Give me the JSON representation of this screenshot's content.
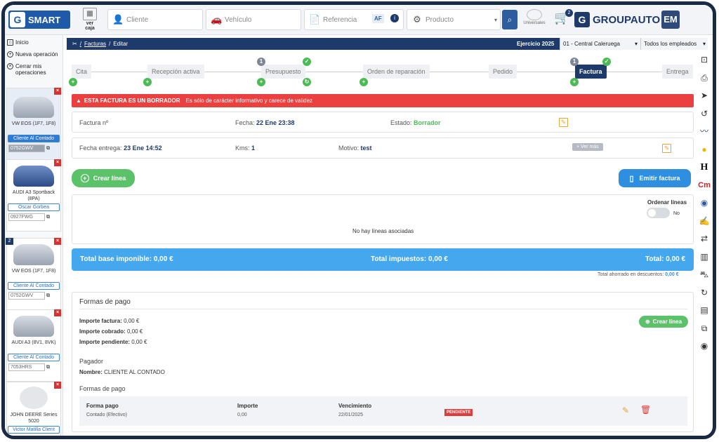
{
  "app": {
    "logo_text": "SMART",
    "caja_label": "ver caja",
    "brand": "GROUPAUTO",
    "avatar": "EM",
    "cart_count": "2",
    "universales": "Universales"
  },
  "search": {
    "cliente": "Cliente",
    "vehiculo": "Vehículo",
    "referencia": "Referencia",
    "af": "AF",
    "producto": "Producto"
  },
  "leftnav": {
    "inicio": "Inicio",
    "nueva": "Nueva operación",
    "cerrar": "Cerrar mis operaciones"
  },
  "cards": [
    {
      "name": "VW EOS (1F7, 1F8)",
      "client": "Cliente Al Contado",
      "plate": "0752GWV"
    },
    {
      "name": "AUDI A3 Sportback (8PA)",
      "client": "Oscar Gorbea",
      "plate": "0927FWG"
    },
    {
      "name": "VW EOS (1F7, 1F8)",
      "client": "Cliente Al Contado",
      "plate": "0752GWV",
      "num": "2"
    },
    {
      "name": "AUDI A3 (8V1, 8VK)",
      "client": "Cliente Al Contado",
      "plate": "7053HRS"
    },
    {
      "name": "JOHN DEERE Series 5020",
      "client": "Victor Matilla Client"
    }
  ],
  "breadcrumb": {
    "facturas": "Facturas",
    "editar": "Editar",
    "ejercicio": "Ejercicio 2025",
    "centro": "01 - Central Caleruega",
    "empleados": "Todos los empleados"
  },
  "steps": [
    "Cita",
    "Recepción activa",
    "Presupuesto",
    "Orden de reparación",
    "Pedido",
    "Factura",
    "Entrega"
  ],
  "step_badges": {
    "presupuesto": "1",
    "factura": "1"
  },
  "alert": {
    "title": "ESTA FACTURA ES UN BORRADOR",
    "text": "Es sólo de carácter informativo y carece de validez"
  },
  "factura": {
    "num_label": "Factura nº",
    "fecha_label": "Fecha:",
    "fecha": "22 Ene 23:38",
    "estado_label": "Estado:",
    "estado": "Borrador",
    "entrega_label": "Fecha entrega:",
    "entrega": "23 Ene 14:52",
    "kms_label": "Kms:",
    "kms": "1",
    "motivo_label": "Motivo:",
    "motivo": "test",
    "ver_mas": "Ver más"
  },
  "actions": {
    "crear_linea": "Crear línea",
    "emitir": "Emitir factura"
  },
  "lines": {
    "ordenar": "Ordenar líneas",
    "no": "No",
    "empty": "No hay líneas asociadas"
  },
  "totals": {
    "base": "Total base imponible: 0,00 €",
    "impuestos": "Total impuestos: 0,00 €",
    "total": "Total: 0,00 €",
    "ahorrado_label": "Total ahorrado en descuentos:",
    "ahorrado": "0,00 €"
  },
  "pago": {
    "title": "Formas de pago",
    "crear": "Crear línea",
    "imp_fact": "Importe factura:",
    "imp_fact_v": "0,00 €",
    "imp_cobr": "Importe cobrado:",
    "imp_cobr_v": "0,00 €",
    "imp_pend": "Importe pendiente:",
    "imp_pend_v": "0,00 €",
    "pagador": "Pagador",
    "nombre_label": "Nombre:",
    "nombre": "CLIENTE AL CONTADO",
    "formas": "Formas de pago",
    "col_forma": "Forma pago",
    "col_importe": "Importe",
    "col_venc": "Vencimiento",
    "forma": "Contado (Efectivo)",
    "importe": "0,00",
    "venc": "22/01/2025",
    "estado": "PENDIENTE"
  }
}
